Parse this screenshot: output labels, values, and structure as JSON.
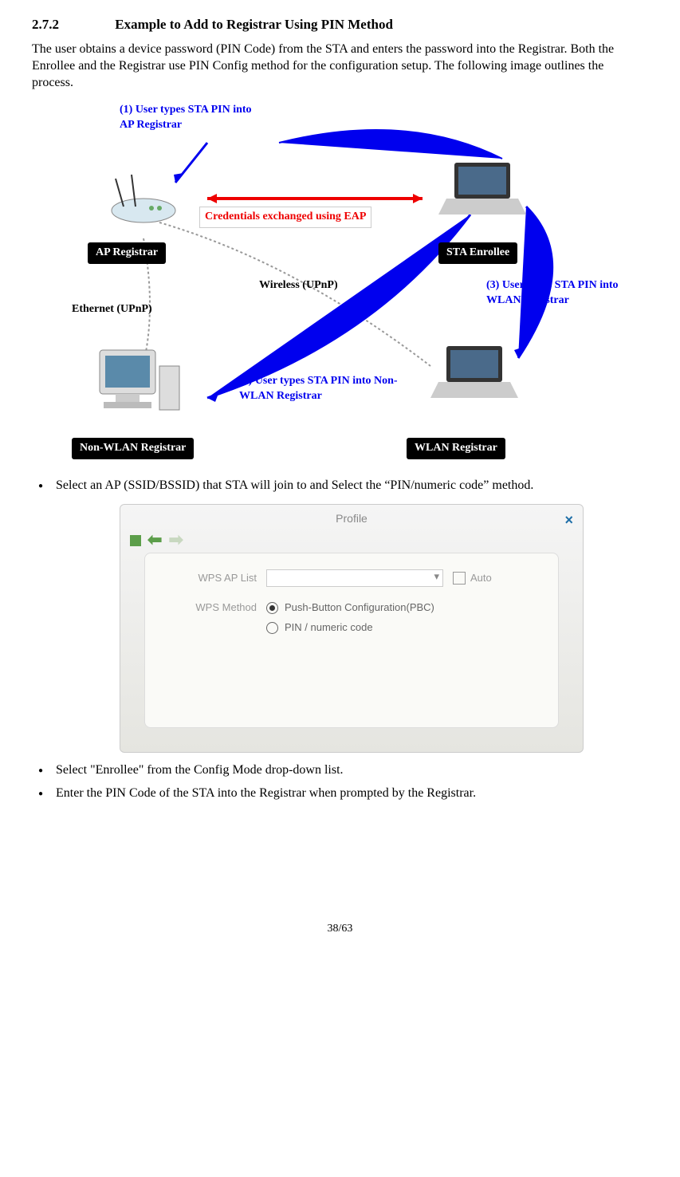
{
  "heading": {
    "number": "2.7.2",
    "title": "Example to Add to Registrar Using PIN Method"
  },
  "intro": "The user obtains a device password (PIN Code) from the STA and enters the password into the Registrar. Both the Enrollee and the Registrar use PIN Config method for the configuration setup. The following image outlines the process.",
  "diagram": {
    "label1": "(1) User types STA PIN into AP Registrar",
    "cred_label": "Credentials exchanged using EAP",
    "ap_registrar": "AP Registrar",
    "sta_enrollee": "STA Enrollee",
    "ethernet": "Ethernet (UPnP)",
    "wireless": "Wireless (UPnP)",
    "label2": "(2) User types STA PIN into Non-WLAN Registrar",
    "label3": "(3) User types STA PIN into WLAN Registrar",
    "non_wlan": "Non-WLAN Registrar",
    "wlan": "WLAN Registrar"
  },
  "bullets": {
    "b1": "Select an AP (SSID/BSSID) that STA will join to and Select the “PIN/numeric code” method.",
    "b2": "Select \"Enrollee\" from the Config Mode drop-down list.",
    "b3": "Enter the PIN Code of the STA into the Registrar when prompted by the Registrar."
  },
  "dialog": {
    "title": "Profile",
    "wps_ap_list": "WPS AP List",
    "auto": "Auto",
    "wps_method": "WPS Method",
    "opt_pbc": "Push-Button Configuration(PBC)",
    "opt_pin": "PIN / numeric code"
  },
  "page_number": "38/63"
}
